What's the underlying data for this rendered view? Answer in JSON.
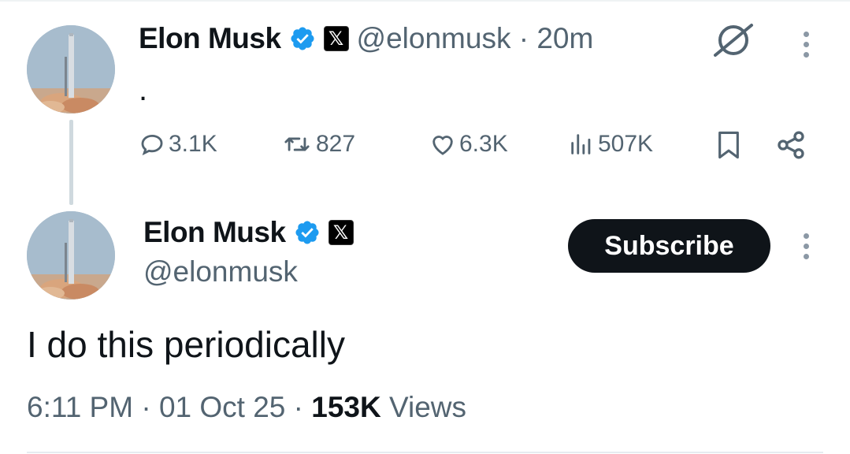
{
  "parent_tweet": {
    "author_name": "Elon Musk",
    "x_badge": "𝕏",
    "handle": "@elonmusk",
    "separator": "·",
    "time_ago": "20m",
    "text": ".",
    "actions": {
      "replies": "3.1K",
      "reposts": "827",
      "likes": "6.3K",
      "views": "507K"
    }
  },
  "main_tweet": {
    "author_name": "Elon Musk",
    "x_badge": "𝕏",
    "handle": "@elonmusk",
    "subscribe_label": "Subscribe",
    "text": "I do this periodically",
    "time": "6:11 PM",
    "date": "01 Oct 25",
    "views_count": "153K",
    "views_label": "Views",
    "separator": "·"
  },
  "colors": {
    "verified_blue": "#1d9bf0",
    "muted_text": "#536471",
    "primary_text": "#0f1419",
    "subscribe_bg": "#0f1419"
  },
  "icons": [
    "verified-icon",
    "x-logo-icon",
    "grok-icon",
    "more-icon",
    "reply-icon",
    "repost-icon",
    "like-icon",
    "views-icon",
    "bookmark-icon",
    "share-icon"
  ]
}
